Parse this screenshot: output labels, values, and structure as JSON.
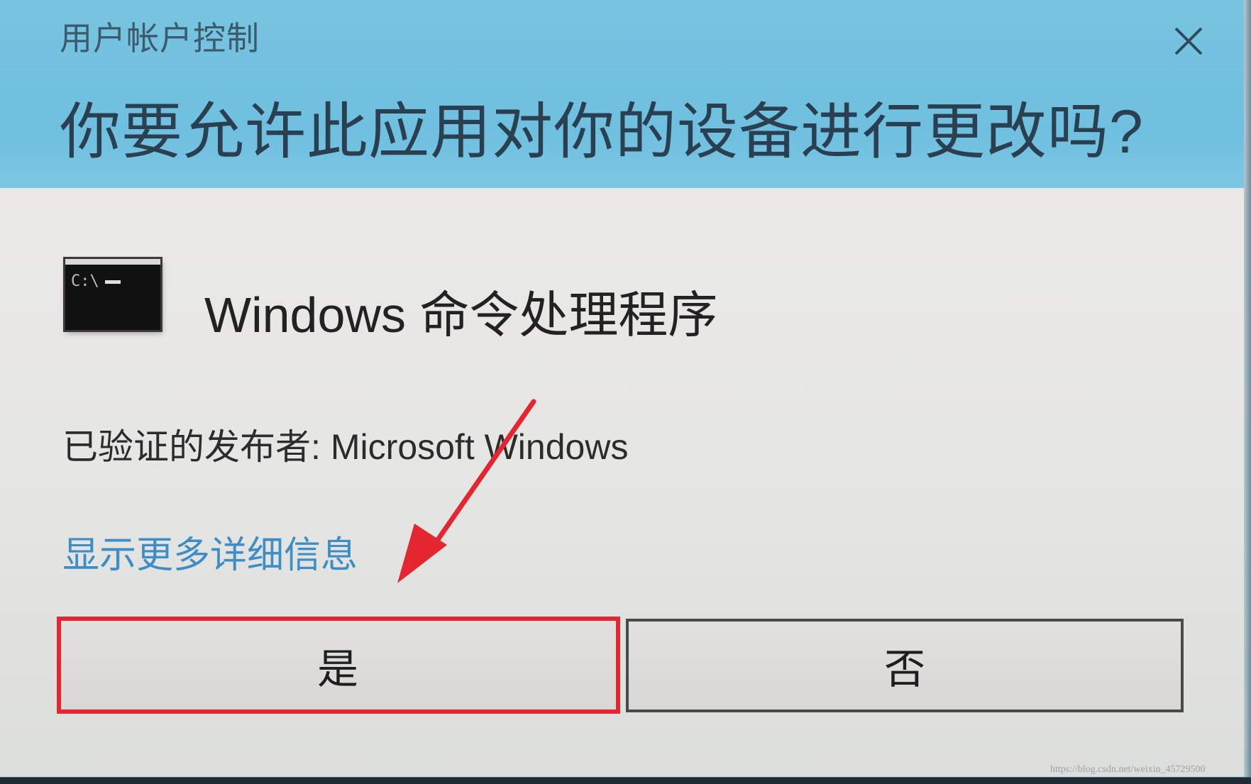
{
  "dialog": {
    "app_title": "用户帐户控制",
    "question": "你要允许此应用对你的设备进行更改吗?",
    "close_icon": "close-icon"
  },
  "app": {
    "icon": "cmd-icon",
    "name": "Windows 命令处理程序"
  },
  "publisher": {
    "label": "已验证的发布者:",
    "value": "Microsoft Windows"
  },
  "details_link": "显示更多详细信息",
  "buttons": {
    "yes": "是",
    "no": "否"
  },
  "annotation": {
    "highlight_color": "#e3262f",
    "arrow_color": "#e3262f"
  },
  "watermark": "https://blog.csdn.net/weixin_45729500",
  "colors": {
    "header_bg": "#6fbfe0",
    "link": "#3d8ec6",
    "body_bg": "#e6e6e4"
  }
}
